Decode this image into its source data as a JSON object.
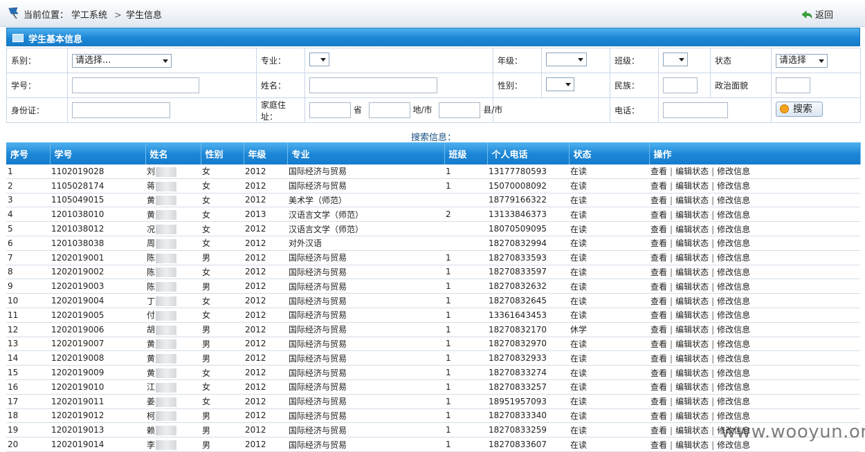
{
  "breadcrumb": {
    "prefix": "当前位置：",
    "level1": "学工系统",
    "separator": ">",
    "level2": "学生信息"
  },
  "back_label": "返回",
  "panel_title": "学生基本信息",
  "form": {
    "dept_label": "系别：",
    "dept_value": "请选择...",
    "major_label": "专业：",
    "grade_label": "年级：",
    "class_label": "班级：",
    "status_label": "状态",
    "status_value": "请选择",
    "id_label": "学号：",
    "name_label": "姓名：",
    "gender_label": "性别：",
    "ethnic_label": "民族：",
    "political_label": "政治面貌",
    "idcard_label": "身份证：",
    "address_label": "家庭住址：",
    "province_suffix": "省",
    "city_suffix": "地/市",
    "county_suffix": "县/市",
    "phone_label": "电话：",
    "search_button": "搜索"
  },
  "result_title": "搜索信息：",
  "columns": [
    "序号",
    "学号",
    "姓名",
    "性别",
    "年级",
    "专业",
    "班级",
    "个人电话",
    "状态",
    "操作"
  ],
  "actions": {
    "view": "查看",
    "edit_status": "编辑状态",
    "edit_info": "修改信息",
    "sep": "|"
  },
  "rows": [
    {
      "n": "1",
      "id": "1102019028",
      "name": "刘",
      "gender": "女",
      "grade": "2012",
      "major": "国际经济与贸易",
      "cls": "1",
      "phone": "13177780593",
      "status": "在读"
    },
    {
      "n": "2",
      "id": "1105028174",
      "name": "蒋",
      "gender": "女",
      "grade": "2012",
      "major": "国际经济与贸易",
      "cls": "1",
      "phone": "15070008092",
      "status": "在读"
    },
    {
      "n": "3",
      "id": "1105049015",
      "name": "黄",
      "gender": "女",
      "grade": "2012",
      "major": "美术学（师范）",
      "cls": "",
      "phone": "18779166322",
      "status": "在读"
    },
    {
      "n": "4",
      "id": "1201038010",
      "name": "黄",
      "gender": "女",
      "grade": "2013",
      "major": "汉语言文学（师范）",
      "cls": "2",
      "phone": "13133846373",
      "status": "在读"
    },
    {
      "n": "5",
      "id": "1201038012",
      "name": "况",
      "gender": "女",
      "grade": "2012",
      "major": "汉语言文学（师范）",
      "cls": "",
      "phone": "18070509095",
      "status": "在读"
    },
    {
      "n": "6",
      "id": "1201038038",
      "name": "周",
      "gender": "女",
      "grade": "2012",
      "major": "对外汉语",
      "cls": "",
      "phone": "18270832994",
      "status": "在读"
    },
    {
      "n": "7",
      "id": "1202019001",
      "name": "陈",
      "gender": "男",
      "grade": "2012",
      "major": "国际经济与贸易",
      "cls": "1",
      "phone": "18270833593",
      "status": "在读"
    },
    {
      "n": "8",
      "id": "1202019002",
      "name": "陈",
      "gender": "女",
      "grade": "2012",
      "major": "国际经济与贸易",
      "cls": "1",
      "phone": "18270833597",
      "status": "在读"
    },
    {
      "n": "9",
      "id": "1202019003",
      "name": "陈",
      "gender": "男",
      "grade": "2012",
      "major": "国际经济与贸易",
      "cls": "1",
      "phone": "18270832632",
      "status": "在读"
    },
    {
      "n": "10",
      "id": "1202019004",
      "name": "丁",
      "gender": "女",
      "grade": "2012",
      "major": "国际经济与贸易",
      "cls": "1",
      "phone": "18270832645",
      "status": "在读"
    },
    {
      "n": "11",
      "id": "1202019005",
      "name": "付",
      "gender": "女",
      "grade": "2012",
      "major": "国际经济与贸易",
      "cls": "1",
      "phone": "13361643453",
      "status": "在读"
    },
    {
      "n": "12",
      "id": "1202019006",
      "name": "胡",
      "gender": "男",
      "grade": "2012",
      "major": "国际经济与贸易",
      "cls": "1",
      "phone": "18270832170",
      "status": "休学"
    },
    {
      "n": "13",
      "id": "1202019007",
      "name": "黄",
      "gender": "男",
      "grade": "2012",
      "major": "国际经济与贸易",
      "cls": "1",
      "phone": "18270832970",
      "status": "在读"
    },
    {
      "n": "14",
      "id": "1202019008",
      "name": "黄",
      "gender": "男",
      "grade": "2012",
      "major": "国际经济与贸易",
      "cls": "1",
      "phone": "18270832933",
      "status": "在读"
    },
    {
      "n": "15",
      "id": "1202019009",
      "name": "黄",
      "gender": "女",
      "grade": "2012",
      "major": "国际经济与贸易",
      "cls": "1",
      "phone": "18270833274",
      "status": "在读"
    },
    {
      "n": "16",
      "id": "1202019010",
      "name": "江",
      "gender": "女",
      "grade": "2012",
      "major": "国际经济与贸易",
      "cls": "1",
      "phone": "18270833257",
      "status": "在读"
    },
    {
      "n": "17",
      "id": "1202019011",
      "name": "姜",
      "gender": "女",
      "grade": "2012",
      "major": "国际经济与贸易",
      "cls": "1",
      "phone": "18951957093",
      "status": "在读"
    },
    {
      "n": "18",
      "id": "1202019012",
      "name": "柯",
      "gender": "男",
      "grade": "2012",
      "major": "国际经济与贸易",
      "cls": "1",
      "phone": "18270833340",
      "status": "在读"
    },
    {
      "n": "19",
      "id": "1202019013",
      "name": "赖",
      "gender": "男",
      "grade": "2012",
      "major": "国际经济与贸易",
      "cls": "1",
      "phone": "18270833259",
      "status": "在读"
    },
    {
      "n": "20",
      "id": "1202019014",
      "name": "李",
      "gender": "男",
      "grade": "2012",
      "major": "国际经济与贸易",
      "cls": "1",
      "phone": "18270833607",
      "status": "在读"
    }
  ],
  "watermark": "www.wooyun.org",
  "colors": {
    "header_blue": "#1c86d6",
    "border": "#c7d7e8"
  }
}
